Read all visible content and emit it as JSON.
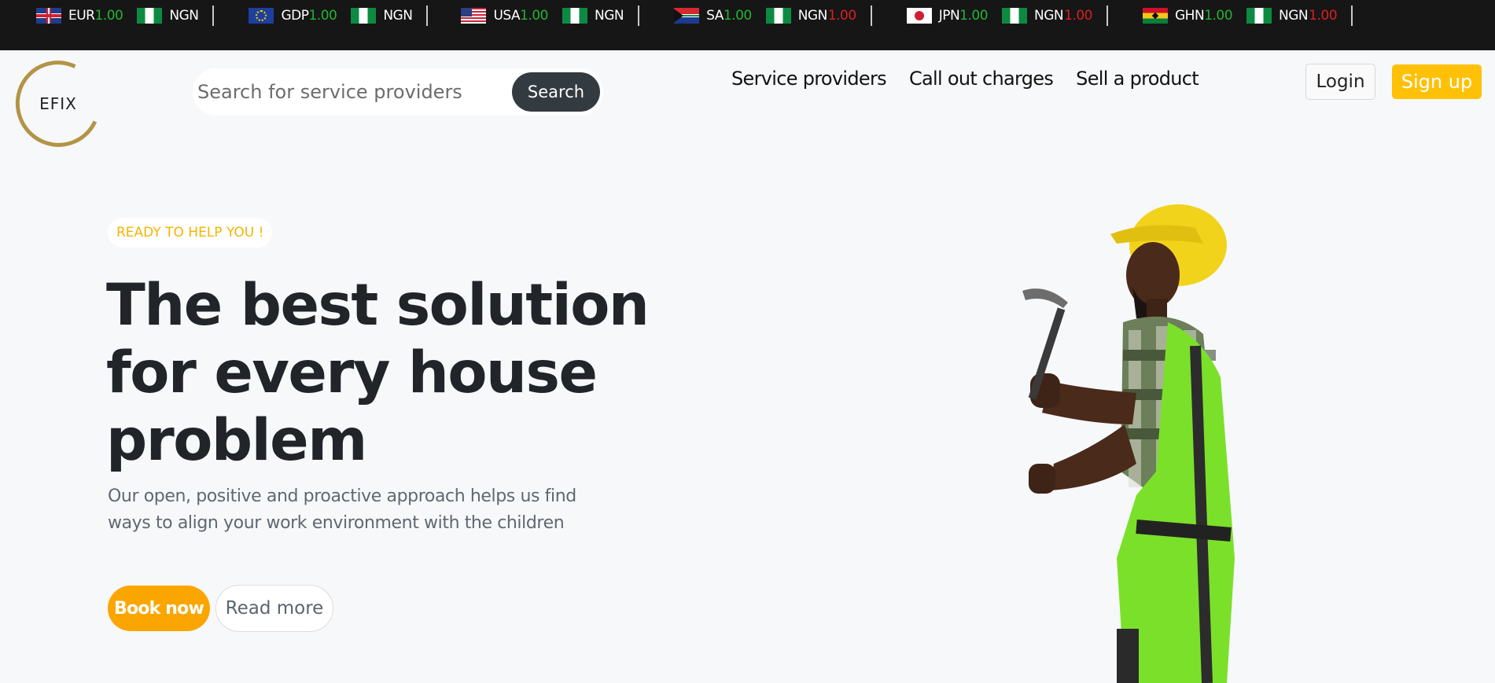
{
  "ticker": [
    {
      "flag": "uk-flag-icon",
      "code": "EUR",
      "value": "1.00",
      "to_flag": "nigeria-flag-icon",
      "to_code": "NGN",
      "to_value": ""
    },
    {
      "flag": "eu-flag-icon",
      "code": "GDP",
      "value": "1.00",
      "to_flag": "nigeria-flag-icon",
      "to_code": "NGN",
      "to_value": ""
    },
    {
      "flag": "us-flag-icon",
      "code": "USA",
      "value": "1.00",
      "to_flag": "nigeria-flag-icon",
      "to_code": "NGN",
      "to_value": ""
    },
    {
      "flag": "south-africa-flag-icon",
      "code": "SA",
      "value": "1.00",
      "to_flag": "nigeria-flag-icon",
      "to_code": "NGN",
      "to_value": "1.00"
    },
    {
      "flag": "japan-flag-icon",
      "code": "JPN",
      "value": "1.00",
      "to_flag": "nigeria-flag-icon",
      "to_code": "NGN",
      "to_value": "1.00"
    },
    {
      "flag": "ghana-flag-icon",
      "code": "GHN",
      "value": "1.00",
      "to_flag": "nigeria-flag-icon",
      "to_code": "NGN",
      "to_value": "1.00"
    }
  ],
  "colors": {
    "up": "#25b334",
    "down": "#d92020",
    "accent": "#ffc107",
    "book": "#fba600",
    "dark": "#161616"
  },
  "header": {
    "logo_text": "EFIX",
    "search_placeholder": "Search for service providers",
    "search_button": "Search",
    "nav": [
      "Service providers",
      "Call out charges",
      "Sell a product"
    ],
    "login": "Login",
    "signup": "Sign up"
  },
  "hero": {
    "badge": "READY TO HELP YOU !",
    "title_lines": [
      "The best solution",
      "for every house",
      "problem"
    ],
    "subtitle_lines": [
      "Our open, positive and proactive approach helps us find",
      "ways to align your work environment with the children"
    ],
    "book_button": "Book now",
    "read_button": "Read more"
  }
}
